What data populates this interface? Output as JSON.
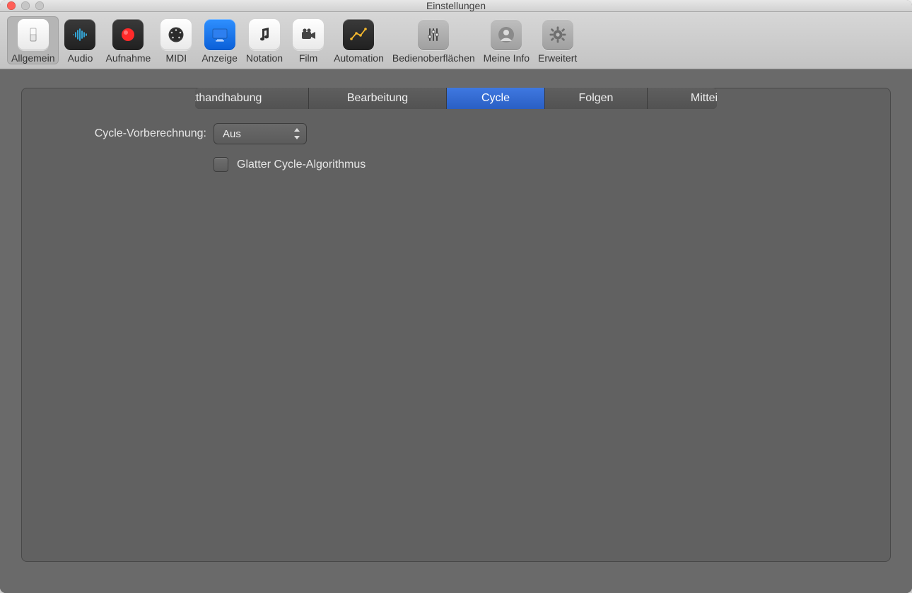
{
  "window": {
    "title": "Einstellungen"
  },
  "toolbar": [
    {
      "name": "allgemein",
      "label": "Allgemein",
      "icon": "switch",
      "active": true
    },
    {
      "name": "audio",
      "label": "Audio",
      "icon": "wave",
      "active": false
    },
    {
      "name": "aufnahme",
      "label": "Aufnahme",
      "icon": "record",
      "active": false
    },
    {
      "name": "midi",
      "label": "MIDI",
      "icon": "midi",
      "active": false
    },
    {
      "name": "anzeige",
      "label": "Anzeige",
      "icon": "display",
      "active": false
    },
    {
      "name": "notation",
      "label": "Notation",
      "icon": "note",
      "active": false
    },
    {
      "name": "film",
      "label": "Film",
      "icon": "camera",
      "active": false
    },
    {
      "name": "automation",
      "label": "Automation",
      "icon": "curve",
      "active": false
    },
    {
      "name": "bedienoberflachen",
      "label": "Bedienoberflächen",
      "icon": "sliders",
      "active": false
    },
    {
      "name": "meine-info",
      "label": "Meine Info",
      "icon": "person",
      "active": false
    },
    {
      "name": "erweitert",
      "label": "Erweitert",
      "icon": "gear",
      "active": false
    }
  ],
  "tabs": [
    {
      "name": "projekthandhabung",
      "label": "Projekthandhabung",
      "active": false
    },
    {
      "name": "bearbeitung",
      "label": "Bearbeitung",
      "active": false
    },
    {
      "name": "cycle",
      "label": "Cycle",
      "active": true
    },
    {
      "name": "folgen",
      "label": "Folgen",
      "active": false
    },
    {
      "name": "mitteilungen",
      "label": "Mitteilungen",
      "active": false
    }
  ],
  "form": {
    "preprocess": {
      "label": "Cycle-Vorberechnung:",
      "value": "Aus"
    },
    "smooth": {
      "label": "Glatter Cycle-Algorithmus",
      "checked": false
    }
  }
}
